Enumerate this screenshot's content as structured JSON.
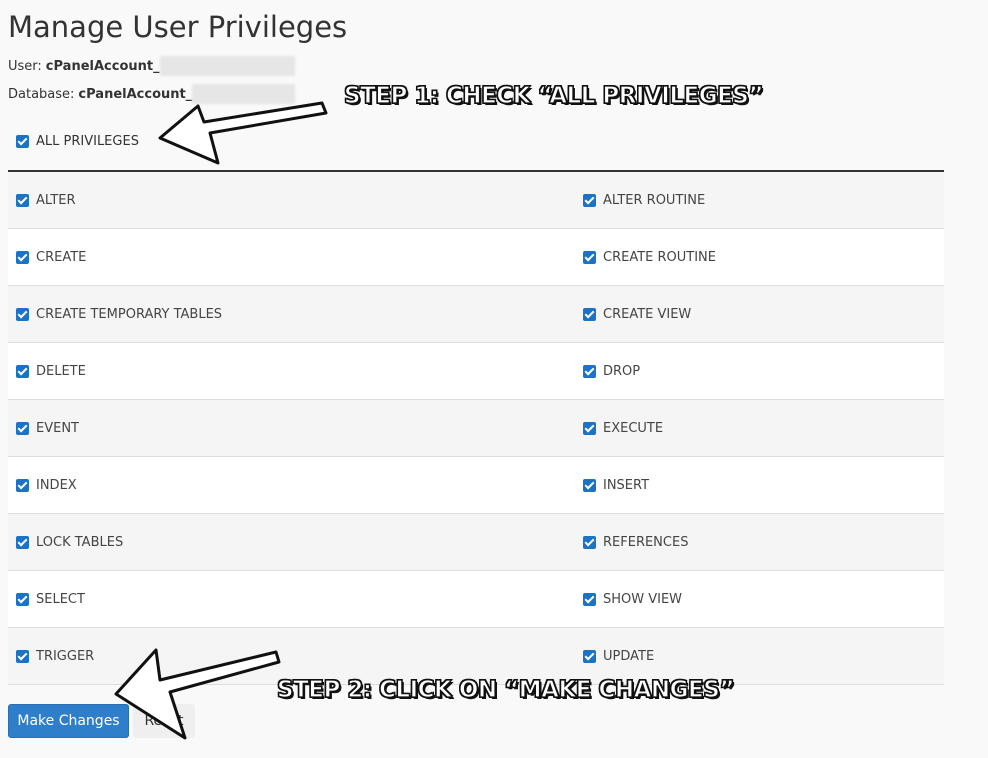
{
  "page": {
    "title": "Manage User Privileges"
  },
  "meta": {
    "user_label": "User:",
    "user_value": "cPanelAccount_",
    "db_label": "Database:",
    "db_value": "cPanelAccount_"
  },
  "all_privileges": {
    "label": "ALL PRIVILEGES",
    "checked": true
  },
  "privileges": {
    "rows": [
      {
        "left": "ALTER",
        "right": "ALTER ROUTINE"
      },
      {
        "left": "CREATE",
        "right": "CREATE ROUTINE"
      },
      {
        "left": "CREATE TEMPORARY TABLES",
        "right": "CREATE VIEW"
      },
      {
        "left": "DELETE",
        "right": "DROP"
      },
      {
        "left": "EVENT",
        "right": "EXECUTE"
      },
      {
        "left": "INDEX",
        "right": "INSERT"
      },
      {
        "left": "LOCK TABLES",
        "right": "REFERENCES"
      },
      {
        "left": "SELECT",
        "right": "SHOW VIEW"
      },
      {
        "left": "TRIGGER",
        "right": "UPDATE"
      }
    ]
  },
  "buttons": {
    "make_changes": "Make Changes",
    "reset": "Reset"
  },
  "annotations": {
    "step1": "STEP 1: CHECK “ALL PRIVILEGES”",
    "step2": "STEP 2: CLICK ON “MAKE CHANGES”"
  },
  "colors": {
    "accent": "#2f7ec9",
    "checkbox": "#1a73c7"
  }
}
